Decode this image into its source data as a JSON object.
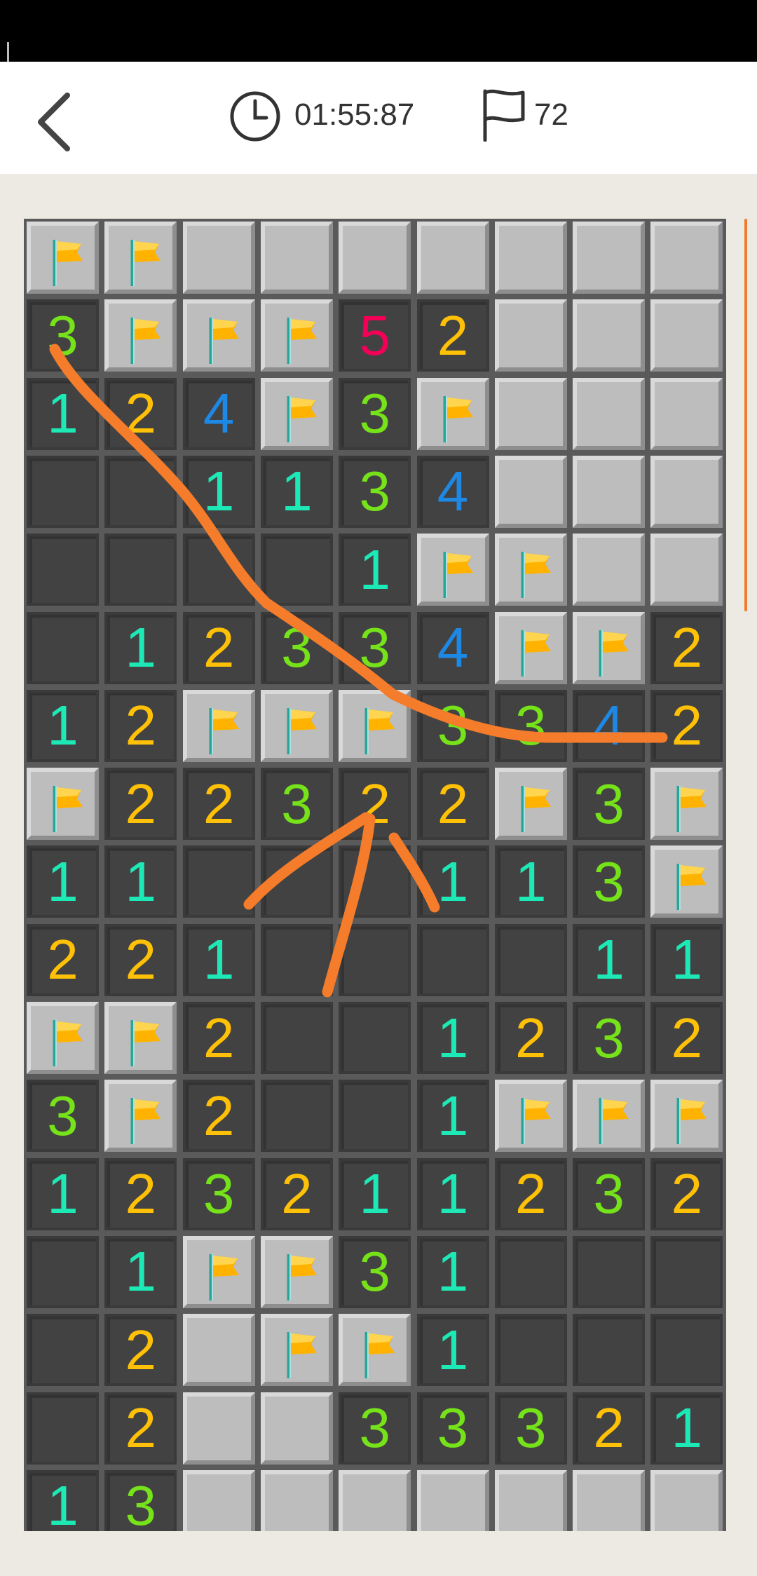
{
  "header": {
    "timer": "01:55:87",
    "flags_remaining": "72"
  },
  "board": {
    "columns": 9,
    "visible_rows": 17,
    "rows": [
      [
        "F",
        "F",
        "#",
        "#",
        "#",
        "#",
        "#",
        "#",
        "#"
      ],
      [
        "3",
        "F",
        "F",
        "F",
        "5",
        "2",
        "#",
        "#",
        "#"
      ],
      [
        "1",
        "2",
        "4",
        "F",
        "3",
        "F",
        "#",
        "#",
        "#"
      ],
      [
        "0",
        "0",
        "1",
        "1",
        "3",
        "4",
        "#",
        "#",
        "#"
      ],
      [
        "0",
        "0",
        "0",
        "0",
        "1",
        "F",
        "F",
        "#",
        "#"
      ],
      [
        "0",
        "1",
        "2",
        "3",
        "3",
        "4",
        "F",
        "F",
        "2"
      ],
      [
        "1",
        "2",
        "F",
        "F",
        "F",
        "3",
        "3",
        "4",
        "2"
      ],
      [
        "F",
        "2",
        "2",
        "3",
        "2",
        "2",
        "F",
        "3",
        "F"
      ],
      [
        "1",
        "1",
        "0",
        "0",
        "0",
        "1",
        "1",
        "3",
        "F"
      ],
      [
        "2",
        "2",
        "1",
        "0",
        "0",
        "0",
        "0",
        "1",
        "1"
      ],
      [
        "F",
        "F",
        "2",
        "0",
        "0",
        "1",
        "2",
        "3",
        "2"
      ],
      [
        "3",
        "F",
        "2",
        "0",
        "0",
        "1",
        "F",
        "F",
        "F"
      ],
      [
        "1",
        "2",
        "3",
        "2",
        "1",
        "1",
        "2",
        "3",
        "2"
      ],
      [
        "0",
        "1",
        "F",
        "F",
        "3",
        "1",
        "0",
        "0",
        "0"
      ],
      [
        "0",
        "2",
        "#",
        "F",
        "F",
        "1",
        "0",
        "0",
        "0"
      ],
      [
        "0",
        "2",
        "#",
        "#",
        "3",
        "3",
        "3",
        "2",
        "1"
      ],
      [
        "1",
        "3",
        "#",
        "#",
        "#",
        "#",
        "#",
        "#",
        "#"
      ]
    ]
  },
  "number_colors": {
    "1": "#1de9b6",
    "2": "#ffc107",
    "3": "#76e21a",
    "4": "#1e88e5",
    "5": "#f50057"
  },
  "icons": {
    "back": "chevron-left-icon",
    "timer": "clock-icon",
    "flag_counter": "flag-outline-icon",
    "cell_flag": "yellow-flag-icon"
  },
  "annotation_color": "#f57c2a"
}
